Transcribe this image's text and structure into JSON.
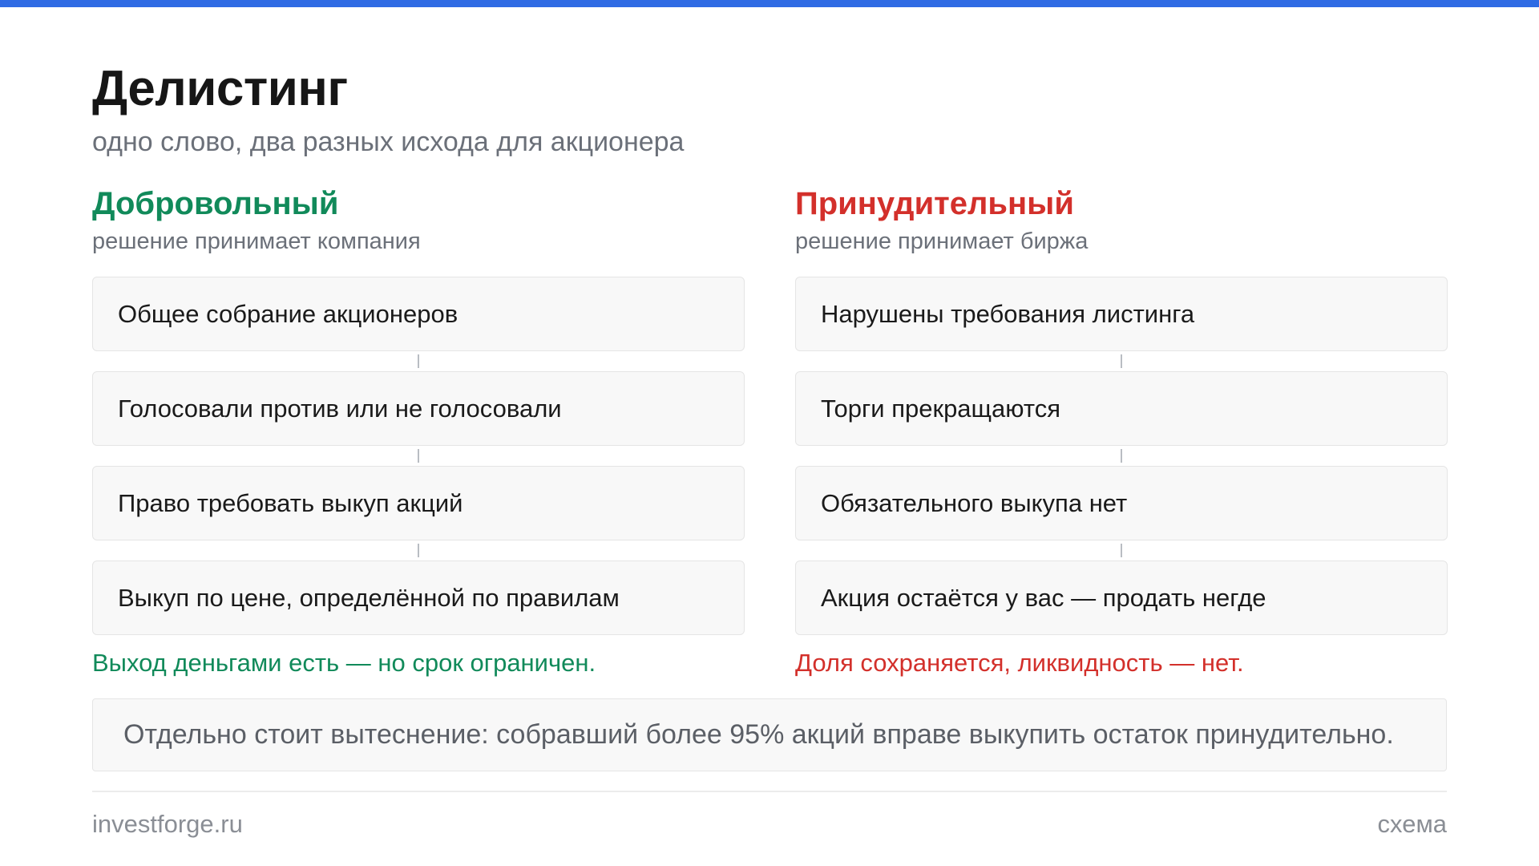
{
  "title": "Делистинг",
  "subtitle": "одно слово, два разных исхода для акционера",
  "colors": {
    "accent_bar": "#2f6be4",
    "voluntary": "#118a5a",
    "forced": "#d3302b"
  },
  "voluntary": {
    "heading": "Добровольный",
    "subheading": "решение принимает компания",
    "steps": [
      "Общее собрание акционеров",
      "Голосовали против или не голосовали",
      "Право требовать выкуп акций",
      "Выкуп по цене, определённой по правилам"
    ],
    "conclusion": "Выход деньгами есть — но срок ограничен."
  },
  "forced": {
    "heading": "Принудительный",
    "subheading": "решение принимает биржа",
    "steps": [
      "Нарушены требования листинга",
      "Торги прекращаются",
      "Обязательного выкупа нет",
      "Акция остаётся у вас — продать негде"
    ],
    "conclusion": "Доля сохраняется, ликвидность — нет."
  },
  "note": "Отдельно стоит вытеснение: собравший более 95% акций вправе выкупить остаток принудительно.",
  "footer": {
    "site": "investforge.ru",
    "label": "схема"
  }
}
